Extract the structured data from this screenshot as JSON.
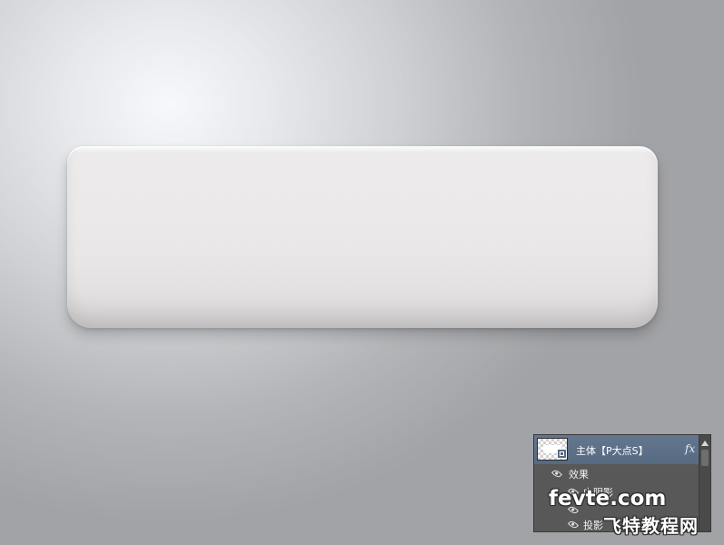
{
  "canvas": {
    "background_colors": [
      "#f6f8fb",
      "#cfd1d4",
      "#a2a3a6"
    ]
  },
  "ac_body": {
    "fill_color": "#eceaea",
    "shadow_color": "#d9d7d7"
  },
  "layers_panel": {
    "layer": {
      "name": "主体【P大点S】",
      "thumbnail_icon": "transparency-checker-thumbnail",
      "link_icon": "layer-mask-link-icon",
      "fx_label": "fx",
      "highlight_color": "#566a82"
    },
    "effects": {
      "group_label": "效果",
      "items": [
        {
          "label": "内阴影",
          "icon": "eye-icon"
        },
        {
          "label": "",
          "icon": "eye-icon"
        },
        {
          "label": "投影",
          "icon": "eye-icon"
        }
      ]
    },
    "scrollbar": {
      "up_icon": "scroll-up-arrow-icon"
    }
  },
  "watermark": {
    "domain": "fevte.com",
    "chinese": "飞特教程网"
  }
}
